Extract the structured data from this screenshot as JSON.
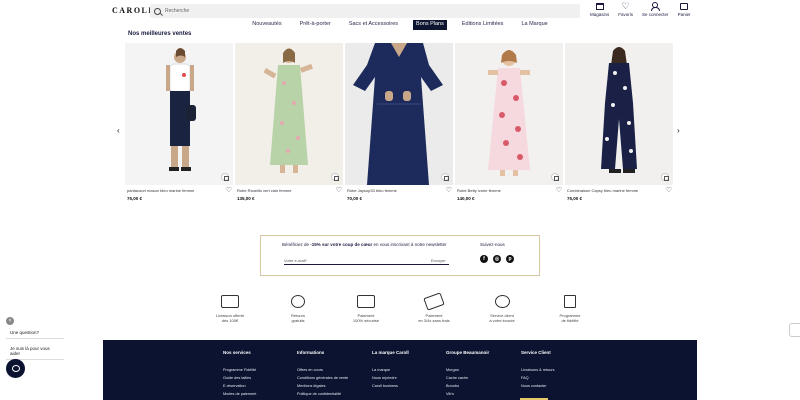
{
  "header": {
    "logo": "CAROLL",
    "search_placeholder": "Recherche",
    "actions": [
      {
        "label": "Magasins",
        "icon": "store-icon"
      },
      {
        "label": "Favoris",
        "icon": "heart-icon"
      },
      {
        "label": "Se connecter",
        "icon": "user-icon"
      },
      {
        "label": "Panier",
        "icon": "bag-icon"
      }
    ]
  },
  "nav": {
    "items": [
      "Nouveautés",
      "Prêt-à-porter",
      "Sacs et Accessoires",
      "Bons Plans",
      "Editions Limitées",
      "La Marque"
    ],
    "active": "Bons Plans"
  },
  "bestsellers": {
    "title": "Nos meilleures ventes",
    "products": [
      {
        "name": "pantacourt mason bleu marine femme",
        "price": "75,00 €"
      },
      {
        "name": "Robe Ricarillo vert clair femme",
        "price": "135,00 €"
      },
      {
        "name": "Robe Jaysop33 bleu femme",
        "price": "70,00 €"
      },
      {
        "name": "Robe Betty ivoire femme",
        "price": "140,00 €"
      },
      {
        "name": "Combinaison Capsy bleu marine femme",
        "price": "75,00 €"
      }
    ]
  },
  "newsletter": {
    "text_prefix": "Bénéficiez de ",
    "text_bold": "-15% sur votre coup de cœur",
    "text_suffix": " en vous inscrivant à notre newsletter",
    "email_placeholder": "Votre e-mail*",
    "send_label": "Envoyer",
    "follow_label": "Suivez-nous",
    "socials": [
      "facebook-icon",
      "instagram-icon",
      "pinterest-icon"
    ]
  },
  "services": [
    {
      "line1": "Livraison offerte",
      "line2": "dès 100€",
      "icon": "truck-icon"
    },
    {
      "line1": "Retours",
      "line2": "gratuits",
      "icon": "return-icon"
    },
    {
      "line1": "Paiement",
      "line2": "100% sécurisé",
      "icon": "card-icon"
    },
    {
      "line1": "Paiement",
      "line2": "en 3/4x sans frais",
      "icon": "installments-icon"
    },
    {
      "line1": "Service client",
      "line2": "à votre écoute",
      "icon": "chat-icon"
    },
    {
      "line1": "Programme",
      "line2": "de fidélité",
      "icon": "loyalty-icon"
    }
  ],
  "footer": {
    "columns": [
      {
        "title": "Nos services",
        "links": [
          "Programme Fidélité",
          "Guide des tailles",
          "E-réservation",
          "Modes de paiement"
        ]
      },
      {
        "title": "Informations",
        "links": [
          "Offres en cours",
          "Conditions générales de vente",
          "Mentions légales",
          "Politique de confidentialité"
        ]
      },
      {
        "title": "La marque Caroll",
        "links": [
          "La marque",
          "Nous rejoindre",
          "Caroll business"
        ]
      },
      {
        "title": "Groupe Beaumanoir",
        "links": [
          "Morgan",
          "Cache cache",
          "Bonobo",
          "Vib's"
        ]
      },
      {
        "title": "Service Client",
        "links": [
          "Livraisons & retours",
          "FAQ",
          "Nous contacter"
        ]
      }
    ]
  },
  "chat": {
    "question": "Une question?",
    "help": "Je suis là pour vous aider"
  },
  "colors": {
    "navy": "#0b1330",
    "gold": "#d8c8a2"
  }
}
